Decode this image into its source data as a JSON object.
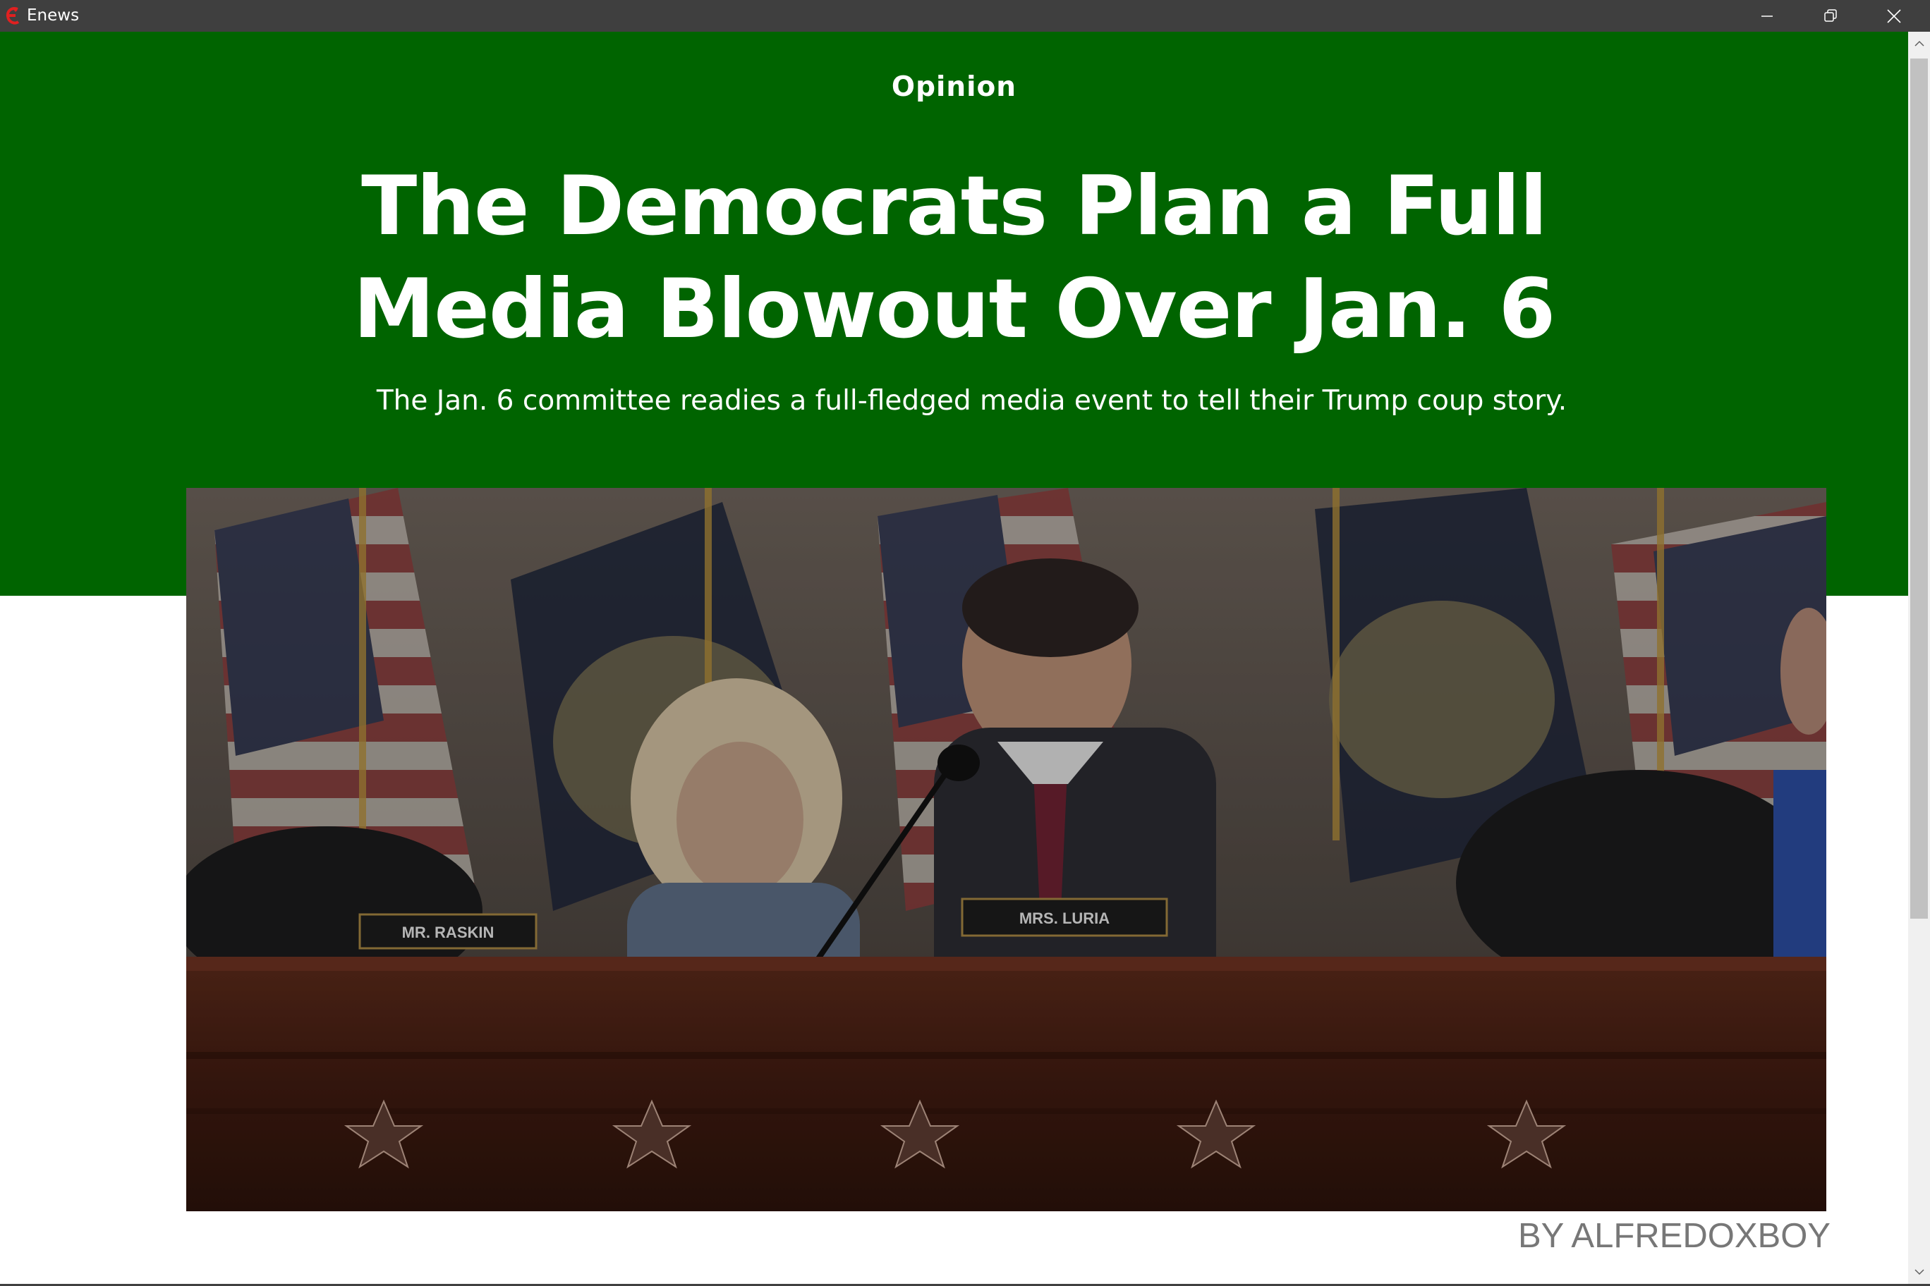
{
  "window": {
    "app_name": "Enews",
    "logo_icon": "enews-logo-icon",
    "controls": [
      "minimize-icon",
      "restore-icon",
      "close-icon"
    ]
  },
  "article": {
    "section": "Opinion",
    "headline": "The Democrats Plan a Full Media Blowout Over Jan. 6",
    "subheadline": "The Jan. 6 committee readies a full-fledged media event to tell their Trump coup story.",
    "image": {
      "nameplate_left": "MR. RASKIN",
      "nameplate_right": "MRS. LURIA"
    },
    "byline": "BY ALFREDOXBOY"
  },
  "colors": {
    "hero_background": "#006400",
    "titlebar": "#3f3f3f",
    "byline": "#777777"
  }
}
